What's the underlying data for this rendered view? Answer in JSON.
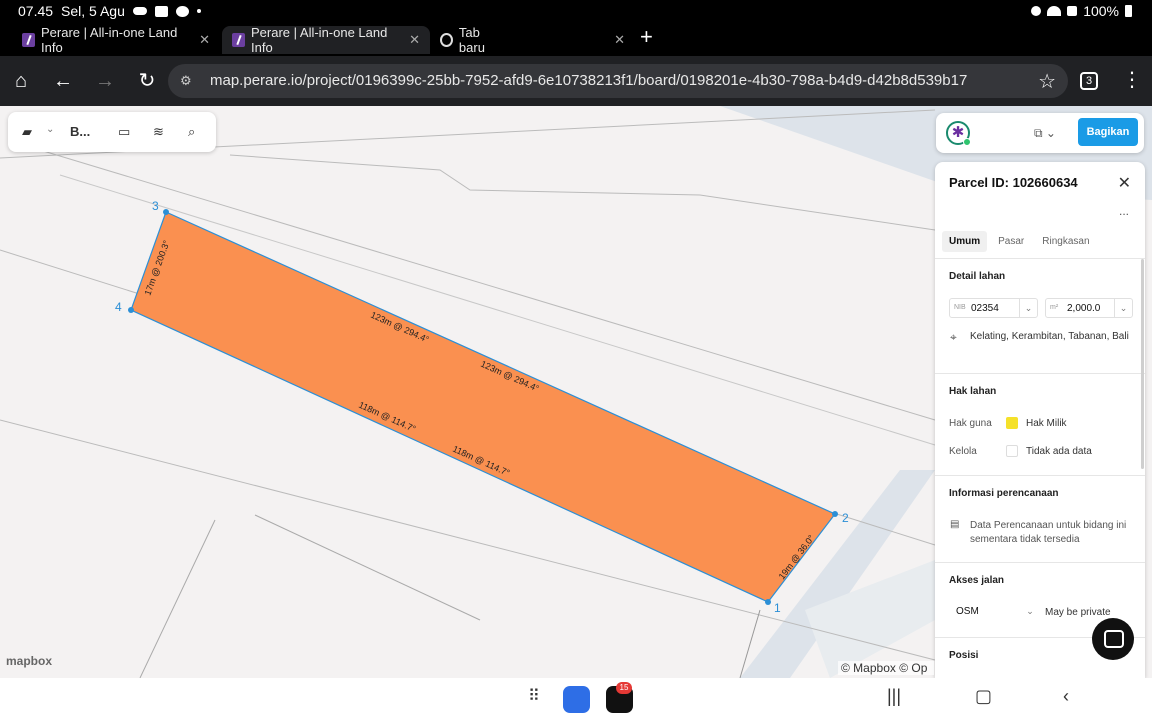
{
  "status_bar": {
    "time": "07.45",
    "date": "Sel, 5 Agu",
    "battery": "100%"
  },
  "tabs": [
    {
      "title": "Perare | All-in-one Land Info",
      "active": false
    },
    {
      "title": "Perare | All-in-one Land Info",
      "active": true
    },
    {
      "title": "Tab baru",
      "active": false
    }
  ],
  "address_bar": {
    "url": "map.perare.io/project/0196399c-25bb-7952-afd9-6e10738213f1/board/0198201e-4b30-798a-b4d9-d42b8d539b17",
    "tab_count": "3"
  },
  "map_toolbar": {
    "basemap_label": "B..."
  },
  "header_right": {
    "share_label": "Bagikan"
  },
  "parcel_panel": {
    "title": "Parcel ID: 102660634",
    "more": "...",
    "tabs": [
      "Umum",
      "Pasar",
      "Ringkasan"
    ],
    "detail": {
      "heading": "Detail lahan",
      "nib_prefix": "NIB",
      "nib_value": "02354",
      "area_prefix": "m²",
      "area_value": "2,000.0",
      "location": "Kelating, Kerambitan, Tabanan, Bali"
    },
    "rights": {
      "heading": "Hak lahan",
      "use_label": "Hak guna",
      "use_value": "Hak Milik",
      "use_color": "#f5e12a",
      "manage_label": "Kelola",
      "manage_value": "Tidak ada data"
    },
    "planning": {
      "heading": "Informasi perencanaan",
      "message": "Data Perencanaan untuk bidang ini sementara tidak tersedia"
    },
    "road": {
      "heading": "Akses jalan",
      "source": "OSM",
      "note": "May be private"
    },
    "position": {
      "heading": "Posisi"
    }
  },
  "parcel_map": {
    "fill_color": "#fa9050",
    "stroke_color": "#2b8fd6",
    "vertices": [
      "1",
      "2",
      "3",
      "4"
    ],
    "edge_labels": [
      "123m @ 294.4°",
      "123m @ 294.4°",
      "118m @ 114.7°",
      "118m @ 114.7°",
      "17m @ 200.3°",
      "19m @ 36.0°"
    ]
  },
  "map_footer": {
    "logo": "mapbox",
    "attribution": "© Mapbox © Op"
  },
  "system_nav": {
    "badge_count": "15"
  }
}
